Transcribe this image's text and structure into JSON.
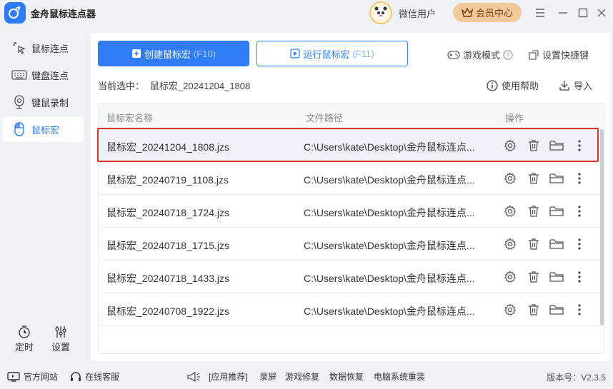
{
  "app": {
    "title": "金舟鼠标连点器",
    "user_name": "微信用户",
    "vip_label": "会员中心"
  },
  "sidebar": {
    "items": [
      {
        "label": "鼠标连点",
        "icon": "click-sparkle-icon"
      },
      {
        "label": "键盘连点",
        "icon": "keyboard-icon"
      },
      {
        "label": "键鼠录制",
        "icon": "record-icon"
      },
      {
        "label": "鼠标宏",
        "icon": "mouse-icon"
      }
    ],
    "bottom": [
      {
        "label": "定时",
        "icon": "timer-icon"
      },
      {
        "label": "设置",
        "icon": "sliders-icon"
      }
    ]
  },
  "toolbar": {
    "create_label": "创建鼠标宏",
    "create_shortcut": "(F10)",
    "run_label": "运行鼠标宏",
    "run_shortcut": "(F11)",
    "game_mode": "游戏模式",
    "set_hotkey": "设置快捷键"
  },
  "current": {
    "label": "当前选中：",
    "value": "鼠标宏_20241204_1808"
  },
  "links": {
    "help": "使用帮助",
    "import": "导入"
  },
  "table": {
    "headers": {
      "name": "鼠标宏名称",
      "path": "文件路径",
      "ops": "操作"
    },
    "rows": [
      {
        "name": "鼠标宏_20241204_1808.jzs",
        "path": "C:\\Users\\kate\\Desktop\\金舟鼠标连点..."
      },
      {
        "name": "鼠标宏_20240719_1108.jzs",
        "path": "C:\\Users\\kate\\Desktop\\金舟鼠标连点..."
      },
      {
        "name": "鼠标宏_20240718_1724.jzs",
        "path": "C:\\Users\\kate\\Desktop\\金舟鼠标连点..."
      },
      {
        "name": "鼠标宏_20240718_1715.jzs",
        "path": "C:\\Users\\kate\\Desktop\\金舟鼠标连点..."
      },
      {
        "name": "鼠标宏_20240718_1433.jzs",
        "path": "C:\\Users\\kate\\Desktop\\金舟鼠标连点..."
      },
      {
        "name": "鼠标宏_20240708_1922.jzs",
        "path": "C:\\Users\\kate\\Desktop\\金舟鼠标连点..."
      }
    ],
    "selected_index": 0
  },
  "footer": {
    "website": "官方网站",
    "support": "在线客服",
    "recommend": "[应用推荐]",
    "apps": [
      "录屏",
      "游戏修复",
      "数据恢复",
      "电脑系统重装"
    ],
    "version": "版本号：V2.3.5"
  },
  "colors": {
    "accent": "#2f7cf6",
    "highlight": "#e0302a",
    "vip": "#f2c99b"
  }
}
